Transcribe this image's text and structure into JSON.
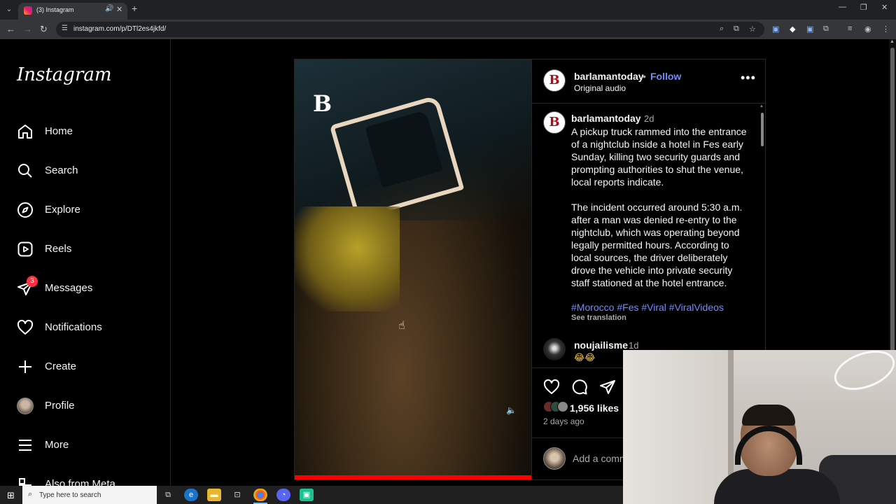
{
  "browser": {
    "tab_title": "(3) Instagram",
    "url": "instagram.com/p/DTl2es4jkfd/"
  },
  "sidebar": {
    "logo": "Instagram",
    "items": [
      {
        "label": "Home",
        "icon": "home-icon"
      },
      {
        "label": "Search",
        "icon": "search-icon"
      },
      {
        "label": "Explore",
        "icon": "compass-icon"
      },
      {
        "label": "Reels",
        "icon": "reels-icon"
      },
      {
        "label": "Messages",
        "icon": "messenger-icon",
        "badge": "3"
      },
      {
        "label": "Notifications",
        "icon": "heart-icon"
      },
      {
        "label": "Create",
        "icon": "plus-icon"
      },
      {
        "label": "Profile",
        "icon": "avatar"
      },
      {
        "label": "More",
        "icon": "hamburger-icon"
      },
      {
        "label": "Also from Meta",
        "icon": "meta-icon"
      }
    ]
  },
  "post": {
    "video_logo": "B",
    "author": {
      "username": "barlamantoday",
      "avatar_letter": "B",
      "follow_label": "Follow",
      "audio": "Original audio"
    },
    "caption": {
      "username": "barlamantoday",
      "time": "2d",
      "text": "A pickup truck rammed into the entrance of a nightclub inside a hotel in Fes early Sunday, killing two security guards and prompting authorities to shut the venue, local reports indicate.\n\nThe incident occurred around 5:30 a.m. after a man was denied re-entry to the nightclub, which was operating beyond legally permitted hours. According to local sources, the driver deliberately drove the vehicle into private security staff stationed at the hotel entrance.",
      "hashtags": "#Morocco #Fes #Viral #ViralVideos",
      "see_translation": "See translation"
    },
    "comment": {
      "username": "noujailisme",
      "time": "1d",
      "text": "😂😂"
    },
    "likes": "1,956 likes",
    "posted_ago": "2 days ago",
    "add_comment_placeholder": "Add a comment..."
  },
  "taskbar": {
    "search_placeholder": "Type here to search"
  },
  "colors": {
    "link_blue": "#708dff",
    "progress_red": "#ff0000",
    "badge_red": "#ff3040"
  }
}
